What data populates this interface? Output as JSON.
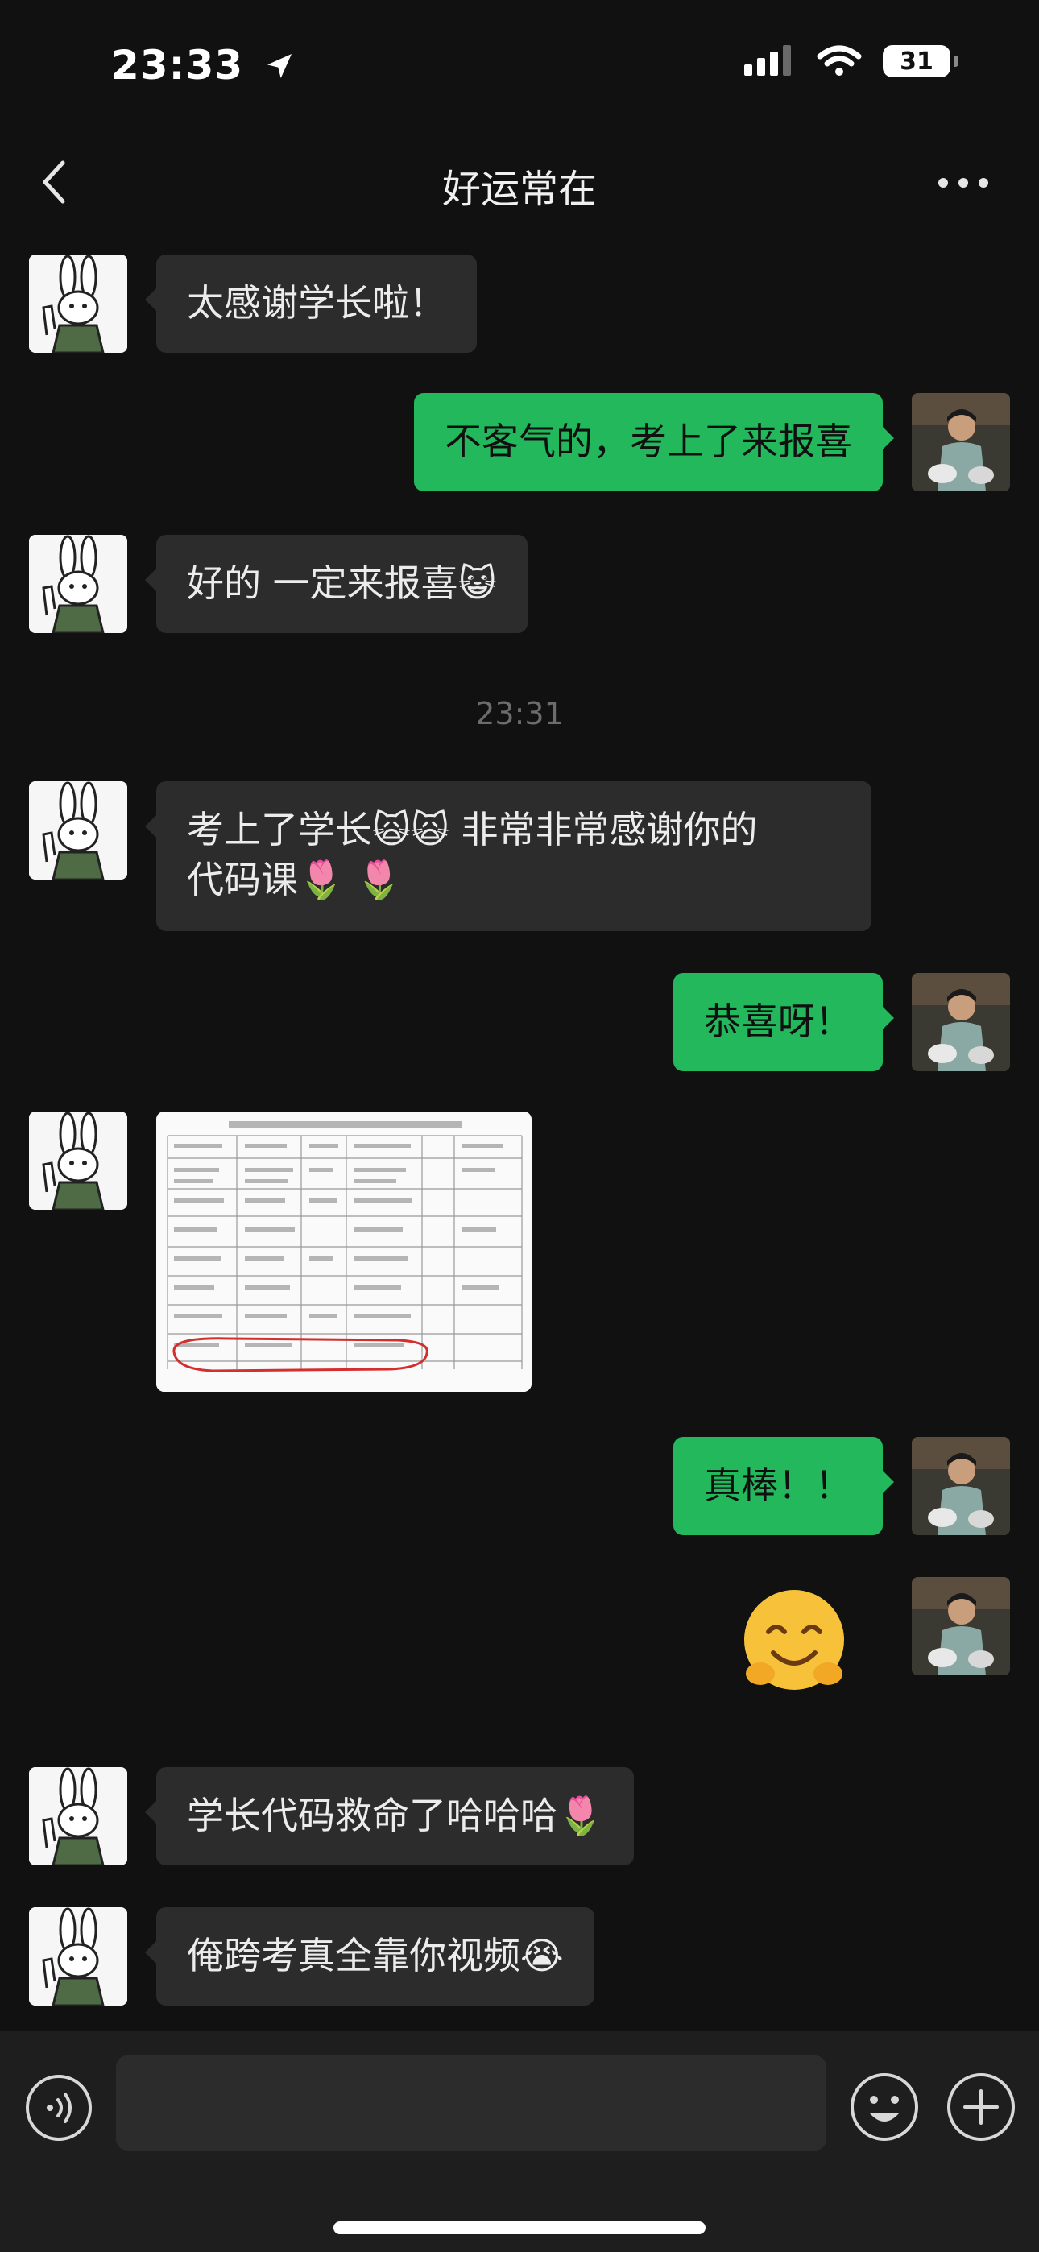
{
  "status_bar": {
    "time": "23:33",
    "battery": "31"
  },
  "header": {
    "title": "好运常在"
  },
  "messages": [
    {
      "side": "in",
      "text": "太感谢学长啦！"
    },
    {
      "side": "out",
      "text": "不客气的，考上了来报喜"
    },
    {
      "side": "in",
      "text": "好的 一定来报喜",
      "emoji": "😺"
    },
    {
      "side": "in",
      "line1": "考上了学长",
      "line1_emoji": "🙀🙀",
      "line1_rest": " 非常非常感谢你的",
      "line2": "代码课",
      "line2_emoji": "🌷 🌷"
    },
    {
      "side": "out",
      "text": "恭喜呀！"
    },
    {
      "side": "in",
      "type": "image"
    },
    {
      "side": "out",
      "text": "真棒！！"
    },
    {
      "side": "out",
      "type": "sticker"
    },
    {
      "side": "in",
      "text": "学长代码救命了哈哈哈",
      "emoji": "🌷"
    },
    {
      "side": "in",
      "text": "俺跨考真全靠你视频",
      "emoji": "😭"
    }
  ],
  "timestamp": "23:31",
  "icons": {
    "back": "chevron-left-icon",
    "more": "more-icon",
    "voice": "voice-icon",
    "emoji": "emoji-icon",
    "plus": "plus-icon"
  },
  "colors": {
    "background": "#111111",
    "incoming_bubble": "#2c2c2c",
    "outgoing_bubble": "#22b85b"
  }
}
